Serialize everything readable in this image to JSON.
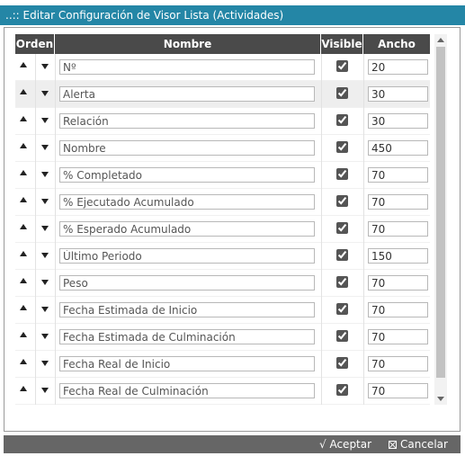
{
  "window": {
    "title": "..:: Editar Configuración de Visor Lista (Actividades)"
  },
  "table": {
    "headers": {
      "orden": "Orden",
      "nombre": "Nombre",
      "visible": "Visible",
      "ancho": "Ancho"
    },
    "rows": [
      {
        "nombre": "Nº",
        "visible": true,
        "ancho": "20"
      },
      {
        "nombre": "Alerta",
        "visible": true,
        "ancho": "30"
      },
      {
        "nombre": "Relación",
        "visible": true,
        "ancho": "30"
      },
      {
        "nombre": "Nombre",
        "visible": true,
        "ancho": "450"
      },
      {
        "nombre": "% Completado",
        "visible": true,
        "ancho": "70"
      },
      {
        "nombre": "% Ejecutado Acumulado",
        "visible": true,
        "ancho": "70"
      },
      {
        "nombre": "% Esperado Acumulado",
        "visible": true,
        "ancho": "70"
      },
      {
        "nombre": "Último Periodo",
        "visible": true,
        "ancho": "150"
      },
      {
        "nombre": "Peso",
        "visible": true,
        "ancho": "70"
      },
      {
        "nombre": "Fecha Estimada de Inicio",
        "visible": true,
        "ancho": "70"
      },
      {
        "nombre": "Fecha Estimada de Culminación",
        "visible": true,
        "ancho": "70"
      },
      {
        "nombre": "Fecha Real de Inicio",
        "visible": true,
        "ancho": "70"
      },
      {
        "nombre": "Fecha Real de Culminación",
        "visible": true,
        "ancho": "70"
      }
    ]
  },
  "footer": {
    "accept_label": "√ Aceptar",
    "cancel_label": "Cancelar"
  },
  "colors": {
    "titlebar": "#2486a6",
    "header": "#4a4a4a",
    "footer": "#666666"
  }
}
